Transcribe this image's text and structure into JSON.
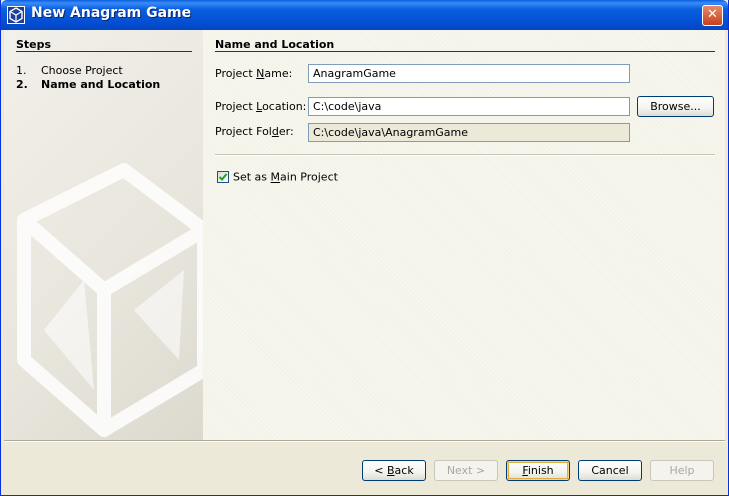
{
  "window": {
    "title": "New Anagram Game",
    "close_symbol": "✕"
  },
  "steps": {
    "heading": "Steps",
    "items": [
      {
        "number": "1.",
        "label": "Choose Project",
        "current": false
      },
      {
        "number": "2.",
        "label": "Name and Location",
        "current": true
      }
    ]
  },
  "main": {
    "heading": "Name and Location",
    "project_name": {
      "label_pre": "Project ",
      "label_mn": "N",
      "label_post": "ame:",
      "value": "AnagramGame"
    },
    "project_location": {
      "label_pre": "Project ",
      "label_mn": "L",
      "label_post": "ocation:",
      "value": "C:\\code\\java"
    },
    "project_folder": {
      "label_pre": "Project Fol",
      "label_mn": "d",
      "label_post": "er:",
      "value": "C:\\code\\java\\AnagramGame"
    },
    "browse_label": "Browse...",
    "main_project": {
      "label_pre": "Set as ",
      "label_mn": "M",
      "label_post": "ain Project",
      "checked": true
    }
  },
  "footer": {
    "back": {
      "pre": "< ",
      "mn": "B",
      "post": "ack",
      "enabled": true
    },
    "next": {
      "label": "Next >",
      "enabled": false
    },
    "finish": {
      "pre": "",
      "mn": "F",
      "post": "inish",
      "enabled": true
    },
    "cancel": {
      "label": "Cancel",
      "enabled": true
    },
    "help": {
      "label": "Help",
      "enabled": false
    }
  },
  "icons": {
    "title_icon": "netbeans-cube-icon",
    "close_icon": "close-icon",
    "check_icon": "checkmark-icon"
  },
  "colors": {
    "titlebar": "#0550d4",
    "window_bg": "#ece9d8",
    "field_border": "#7f9db9"
  }
}
